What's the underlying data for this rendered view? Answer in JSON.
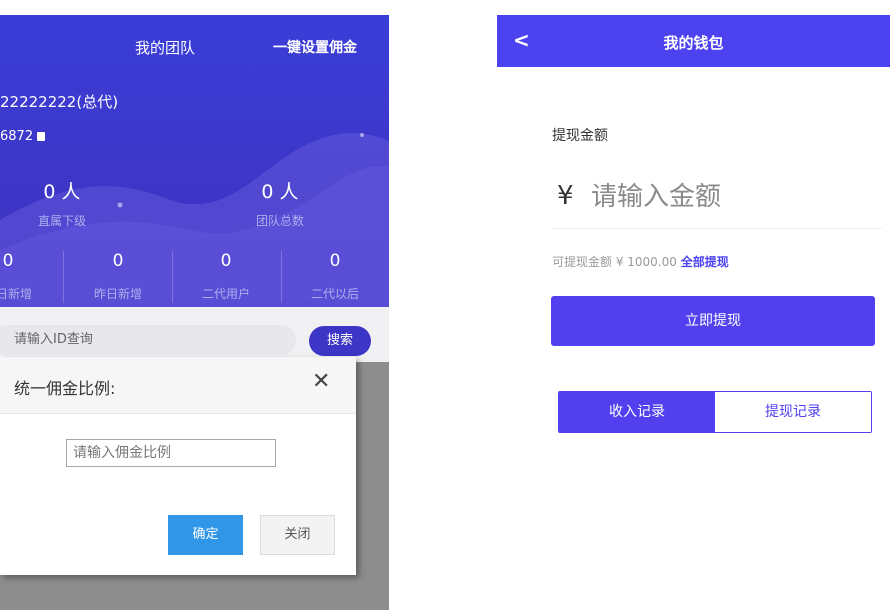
{
  "team_screen": {
    "title": "我的团队",
    "set_commission_label": "一键设置佣金",
    "account": "22222222(总代)",
    "invite_code": "6872",
    "stats_top": [
      {
        "value": "0 人",
        "label": "直属下级"
      },
      {
        "value": "0 人",
        "label": "团队总数"
      }
    ],
    "stats_bottom": [
      {
        "value": "0",
        "label": "今日新增"
      },
      {
        "value": "0",
        "label": "昨日新增"
      },
      {
        "value": "0",
        "label": "二代用户"
      },
      {
        "value": "0",
        "label": "二代以后"
      }
    ],
    "search_placeholder": "请输入ID查询",
    "search_button": "搜索",
    "dialog": {
      "title": "统一佣金比例:",
      "close_glyph": "✕",
      "input_placeholder": "请输入佣金比例",
      "ok_label": "确定",
      "close_label": "关闭"
    }
  },
  "wallet_screen": {
    "back_glyph": "<",
    "title": "我的钱包",
    "amount_label": "提现金额",
    "currency_symbol": "¥",
    "amount_placeholder": "请输入金额",
    "available_text": "可提现金额 ¥ 1000.00",
    "withdraw_all_label": "全部提现",
    "withdraw_button": "立即提现",
    "tabs": [
      {
        "label": "收入记录",
        "active": true
      },
      {
        "label": "提现记录",
        "active": false
      }
    ]
  },
  "colors": {
    "team_header": "#3a3ed8",
    "wallet_accent": "#4d42ef",
    "ok_button": "#2f96e8",
    "overlay": "#8d8d8d"
  }
}
